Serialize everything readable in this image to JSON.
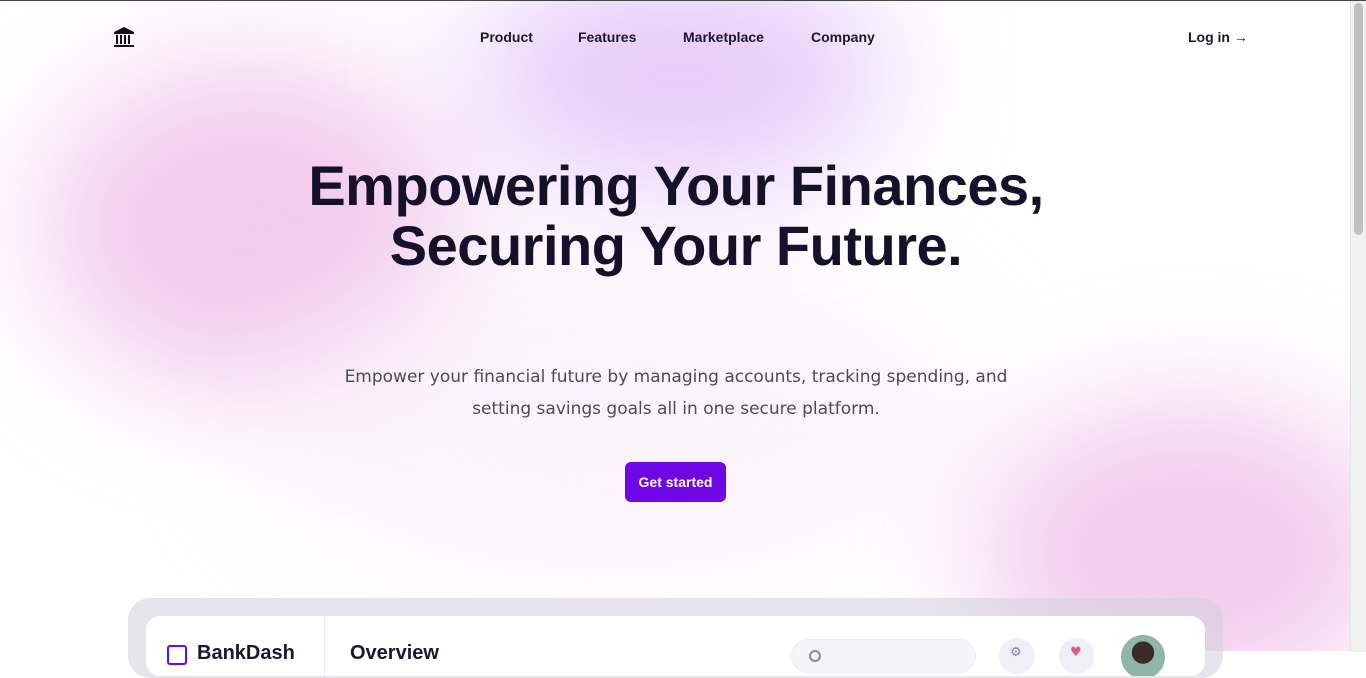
{
  "nav": {
    "logo_icon": "bank-icon",
    "links": [
      {
        "label": "Product"
      },
      {
        "label": "Features"
      },
      {
        "label": "Marketplace"
      },
      {
        "label": "Company"
      }
    ],
    "login_label": "Log in",
    "login_arrow": "→"
  },
  "hero": {
    "title": "Empowering Your Finances, Securing Your Future.",
    "subtitle": "Empower your financial future by managing accounts, tracking spending, and setting savings goals all in one secure platform.",
    "cta_label": "Get started"
  },
  "preview": {
    "brand": "BankDash",
    "page_title": "Overview",
    "icons": [
      "settings-icon",
      "notification-icon"
    ],
    "avatar": "user-avatar"
  },
  "colors": {
    "accent": "#6f06e6",
    "text": "#15112b",
    "muted": "#4b4a5c"
  }
}
